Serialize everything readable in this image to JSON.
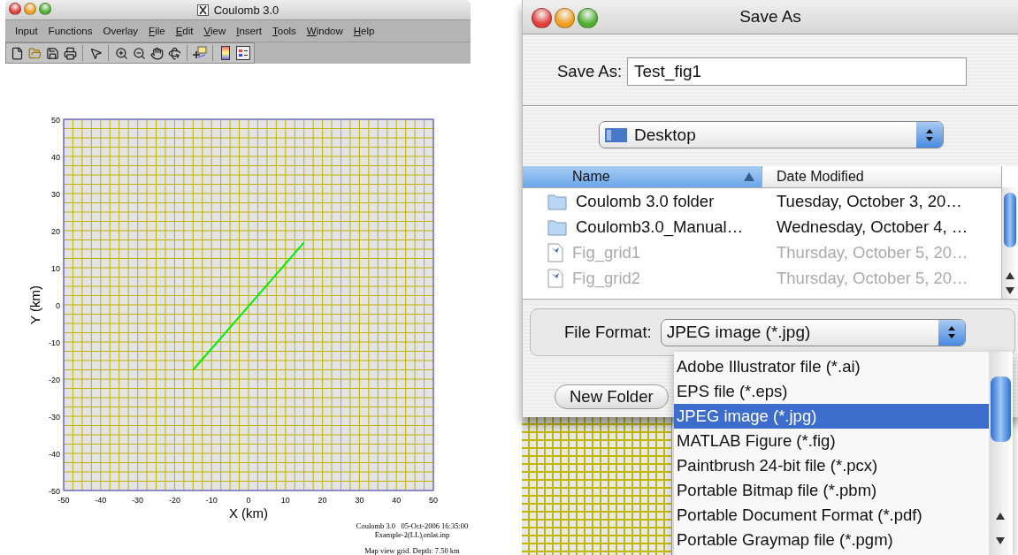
{
  "main_window": {
    "title": "Coulomb 3.0",
    "menu": [
      {
        "label": "Input",
        "mnemonic": false
      },
      {
        "label": "Functions",
        "mnemonic": false
      },
      {
        "label": "Overlay",
        "mnemonic": false
      },
      {
        "label": "File",
        "mnemonic": true
      },
      {
        "label": "Edit",
        "mnemonic": true
      },
      {
        "label": "View",
        "mnemonic": true
      },
      {
        "label": "Insert",
        "mnemonic": true
      },
      {
        "label": "Tools",
        "mnemonic": true
      },
      {
        "label": "Window",
        "mnemonic": true
      },
      {
        "label": "Help",
        "mnemonic": true
      }
    ]
  },
  "plot": {
    "chart_data": {
      "type": "line",
      "xlabel": "X (km)",
      "ylabel": "Y (km)",
      "x": [
        -15,
        15
      ],
      "series": [
        {
          "color": "#00ee00",
          "values": [
            -17.5,
            16.8
          ]
        }
      ],
      "xlim": [
        -50,
        50
      ],
      "ylim": [
        -50,
        50
      ],
      "grid": true,
      "xticks": [
        -50,
        -40,
        -30,
        -20,
        -10,
        0,
        10,
        20,
        30,
        40,
        50
      ],
      "yticks": [
        -50,
        -40,
        -30,
        -20,
        -10,
        0,
        10,
        20,
        30,
        40,
        50
      ]
    },
    "footer": [
      "Coulomb 3.0   05-Oct-2006 16:35:00",
      "Example-2(LL)$_{|}$onlat.inp",
      "Map view grid. Depth: 7.50 km"
    ]
  },
  "save_dialog": {
    "title": "Save As",
    "save_as_label": "Save As:",
    "filename": "Test_fig1",
    "location": "Desktop",
    "columns": [
      {
        "label": "Name",
        "sorted": true
      },
      {
        "label": "Date Modified",
        "sorted": false
      }
    ],
    "files": [
      {
        "kind": "folder",
        "name": "Coulomb 3.0 folder",
        "date": "Tuesday, October 3, 20…",
        "disabled": false
      },
      {
        "kind": "folder",
        "name": "Coulomb3.0_Manual…",
        "date": "Wednesday, October 4, …",
        "disabled": false
      },
      {
        "kind": "image",
        "name": "Fig_grid1",
        "date": "Thursday, October 5, 20…",
        "disabled": true
      },
      {
        "kind": "image",
        "name": "Fig_grid2",
        "date": "Thursday, October 5, 20…",
        "disabled": true
      }
    ],
    "format_label": "File Format:",
    "format": "JPEG image (*.jpg)",
    "buttons": [
      {
        "label": "New Folder",
        "disabled": false
      }
    ],
    "format_menu": [
      {
        "label": "Adobe Illustrator file (*.ai)",
        "selected": false
      },
      {
        "label": "EPS file (*.eps)",
        "selected": false
      },
      {
        "label": "JPEG image (*.jpg)",
        "selected": true
      },
      {
        "label": "MATLAB Figure (*.fig)",
        "selected": false
      },
      {
        "label": "Paintbrush 24-bit file (*.pcx)",
        "selected": false
      },
      {
        "label": "Portable Bitmap file (*.pbm)",
        "selected": false
      },
      {
        "label": "Portable Document Format (*.pdf)",
        "selected": false
      },
      {
        "label": "Portable Graymap file (*.pgm)",
        "selected": false
      }
    ]
  }
}
